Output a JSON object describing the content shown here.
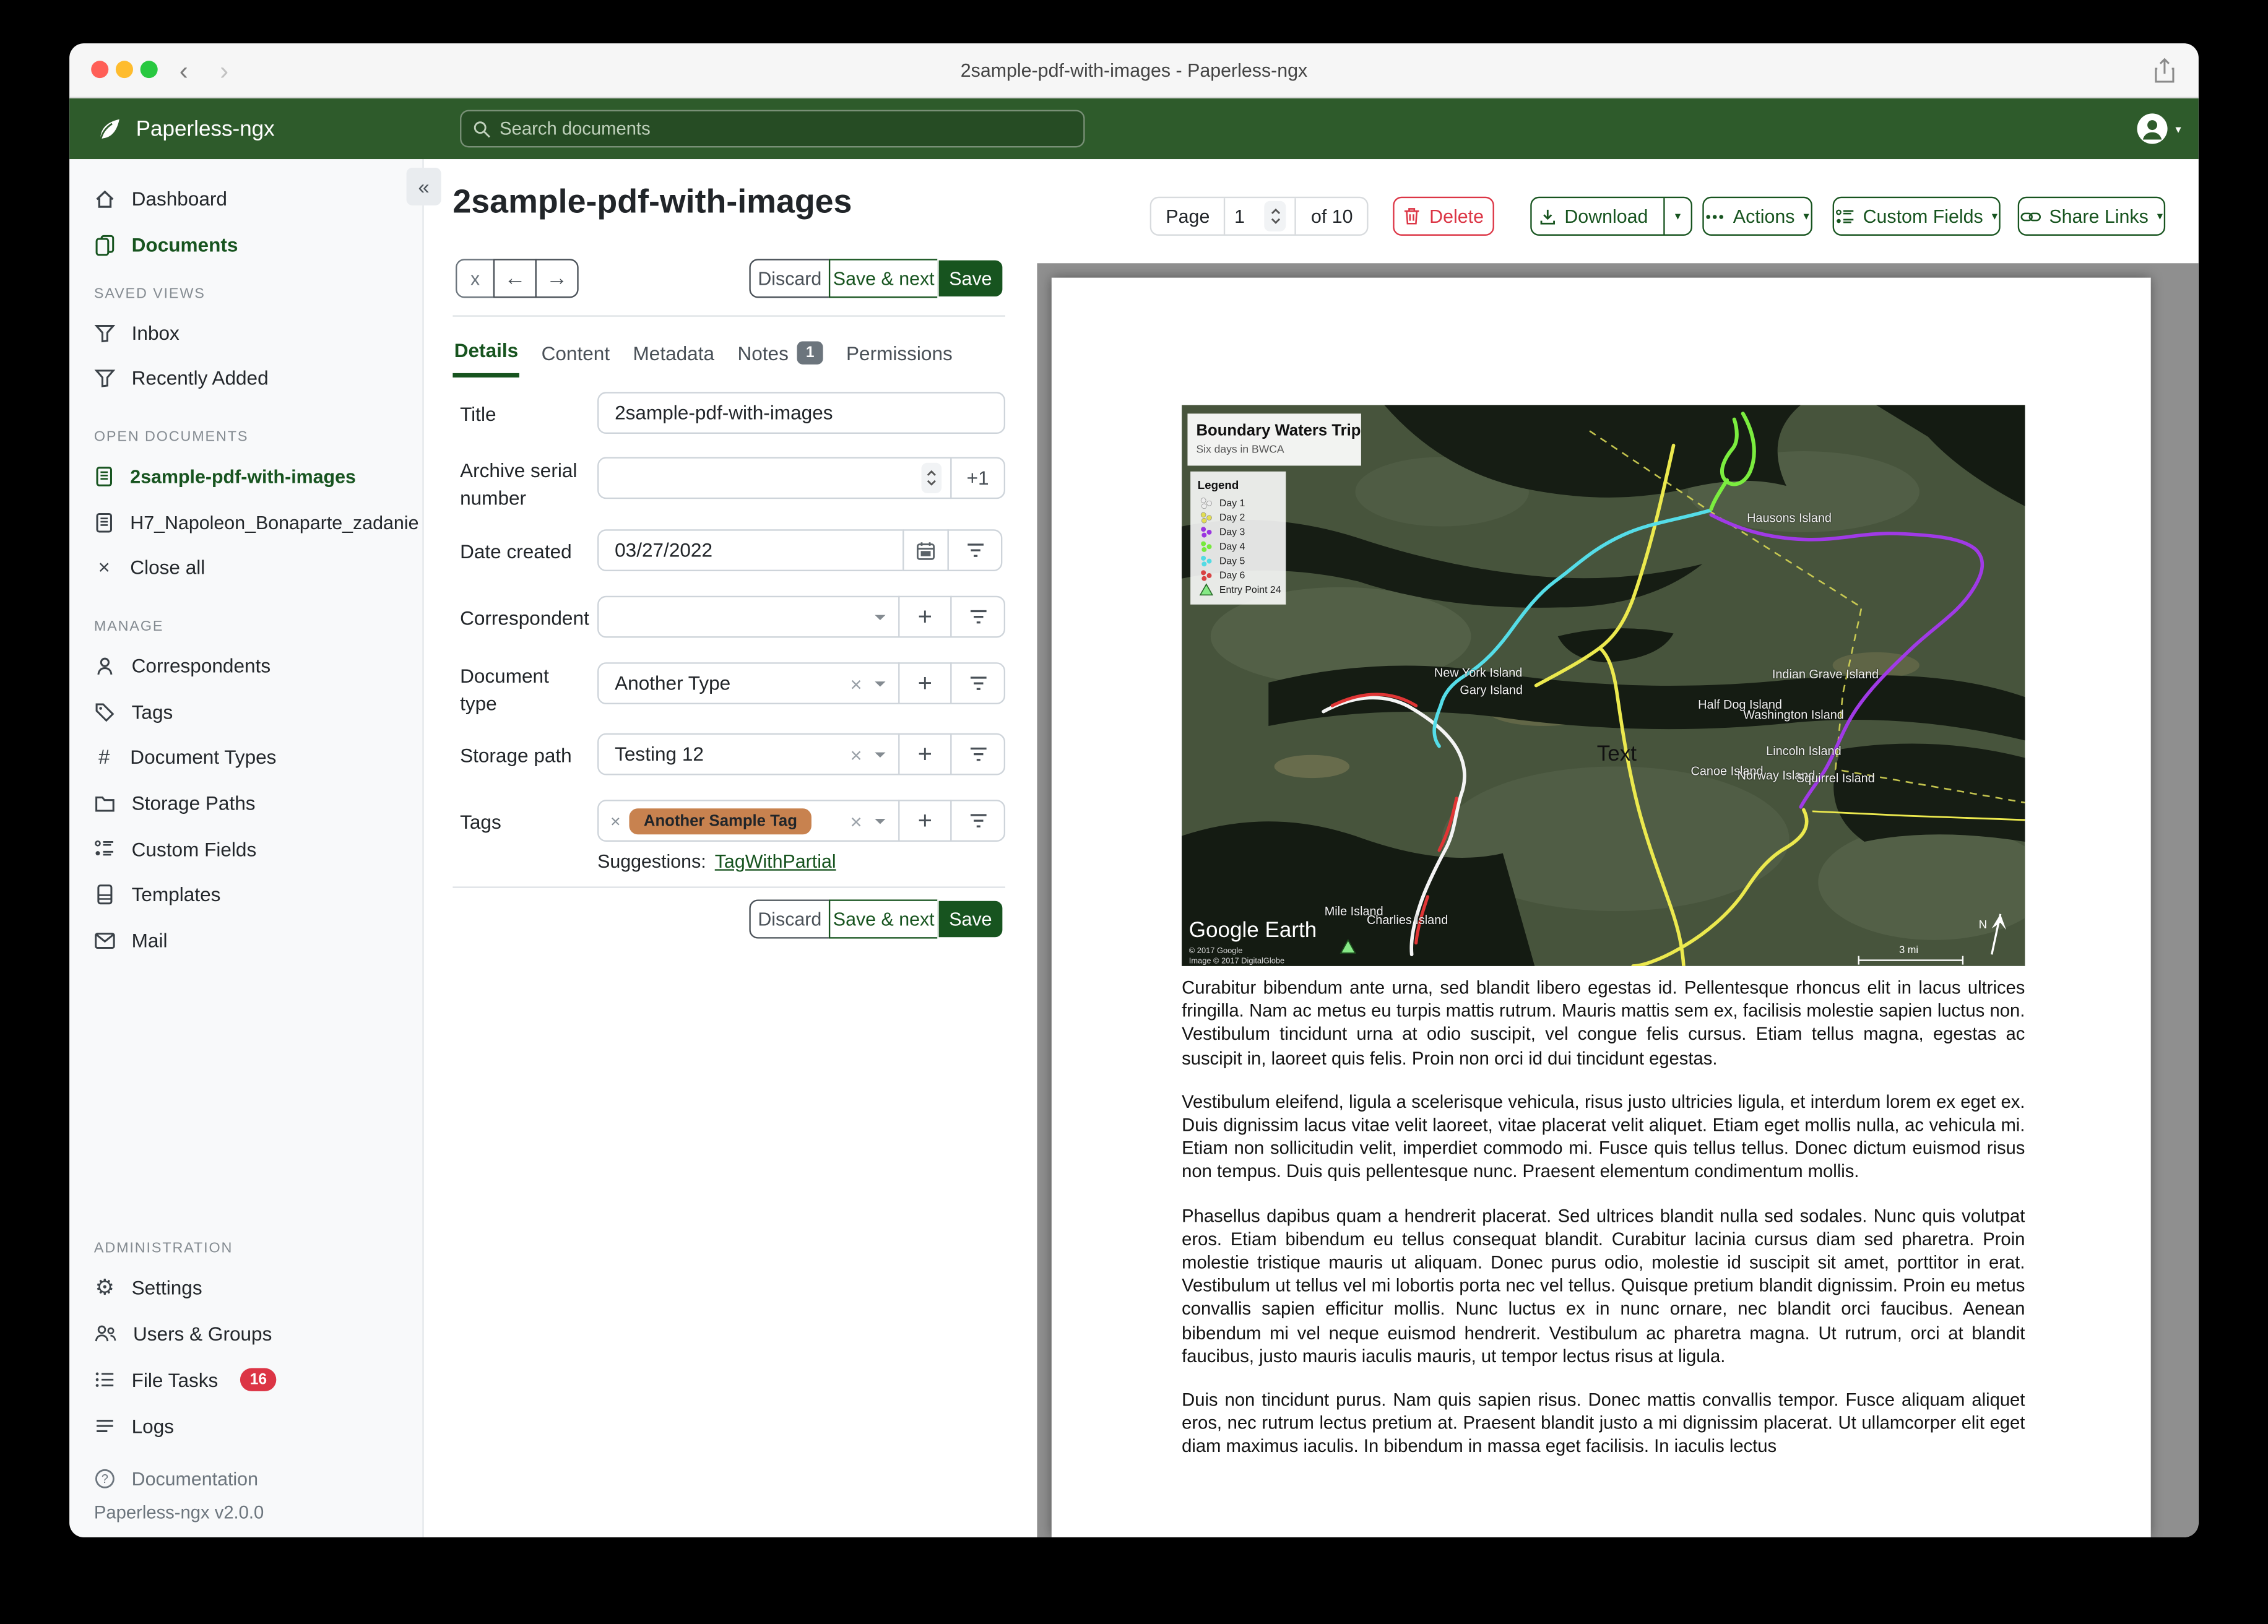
{
  "titlebar": {
    "title": "2sample-pdf-with-images - Paperless-ngx"
  },
  "navbar": {
    "brand": "Paperless-ngx",
    "search_placeholder": "Search documents"
  },
  "sidebar": {
    "primary": [
      {
        "label": "Dashboard"
      },
      {
        "label": "Documents"
      }
    ],
    "sections": [
      {
        "title": "SAVED VIEWS",
        "items": [
          {
            "label": "Inbox"
          },
          {
            "label": "Recently Added"
          }
        ]
      },
      {
        "title": "OPEN DOCUMENTS",
        "items": [
          {
            "label": "2sample-pdf-with-images"
          },
          {
            "label": "H7_Napoleon_Bonaparte_zadanie"
          },
          {
            "label": "Close all"
          }
        ]
      },
      {
        "title": "MANAGE",
        "items": [
          {
            "label": "Correspondents"
          },
          {
            "label": "Tags"
          },
          {
            "label": "Document Types"
          },
          {
            "label": "Storage Paths"
          },
          {
            "label": "Custom Fields"
          },
          {
            "label": "Templates"
          },
          {
            "label": "Mail"
          }
        ]
      },
      {
        "title": "ADMINISTRATION",
        "items": [
          {
            "label": "Settings"
          },
          {
            "label": "Users & Groups"
          },
          {
            "label": "File Tasks",
            "badge": "16"
          },
          {
            "label": "Logs"
          }
        ]
      }
    ],
    "footer": {
      "documentation": "Documentation",
      "version": "Paperless-ngx v2.0.0"
    }
  },
  "header": {
    "title": "2sample-pdf-with-images",
    "page_label": "Page",
    "page_value": "1",
    "page_of": "of 10",
    "delete_label": "Delete",
    "download_label": "Download",
    "actions_label": "Actions",
    "custom_fields_label": "Custom Fields",
    "share_links_label": "Share Links"
  },
  "editor": {
    "discard_label": "Discard",
    "save_next_label": "Save & next",
    "save_label": "Save",
    "tabs": [
      {
        "label": "Details"
      },
      {
        "label": "Content"
      },
      {
        "label": "Metadata"
      },
      {
        "label": "Notes",
        "badge": "1"
      },
      {
        "label": "Permissions"
      }
    ],
    "title": {
      "label": "Title",
      "value": "2sample-pdf-with-images"
    },
    "asn": {
      "label": "Archive serial number",
      "value": "",
      "increment_label": "+1"
    },
    "date_created": {
      "label": "Date created",
      "value": "03/27/2022"
    },
    "correspondent": {
      "label": "Correspondent",
      "value": ""
    },
    "document_type": {
      "label": "Document type",
      "value": "Another Type"
    },
    "storage_path": {
      "label": "Storage path",
      "value": "Testing 12"
    },
    "tags": {
      "label": "Tags",
      "chip": "Another Sample Tag",
      "chip_color": "#c8824f",
      "suggestions_label": "Suggestions:",
      "suggestion_link": "TagWithPartial"
    }
  },
  "preview": {
    "map": {
      "title": "Boundary Waters Trip",
      "subtitle": "Six days in BWCA",
      "legend_title": "Legend",
      "legend": [
        {
          "label": "Day 1",
          "color": "#ededed"
        },
        {
          "label": "Day 2",
          "color": "#e2de52"
        },
        {
          "label": "Day 3",
          "color": "#9a35e0"
        },
        {
          "label": "Day 4",
          "color": "#77e93d"
        },
        {
          "label": "Day 5",
          "color": "#52dbe4"
        },
        {
          "label": "Day 6",
          "color": "#d84343"
        },
        {
          "label": "Entry Point 24",
          "color": "#86e986"
        }
      ],
      "routes": {
        "day1": "#f4f4f4",
        "day2": "#ece94e",
        "day3": "#a03ae6",
        "day4": "#7bed3f",
        "day5": "#55dde8",
        "day6": "#e03535",
        "boundary": "#d6d654"
      },
      "islands": [
        "Hausons Island",
        "New York Island",
        "Gary Island",
        "Indian Grave Island",
        "Half Dog Island",
        "Washington Island",
        "Lincoln Island",
        "Canoe Island",
        "Norway Island",
        "Squirrel Island",
        "Mile Island",
        "Charlies Island"
      ],
      "annotation": "Text",
      "credit_brand": "Google Earth",
      "credit_line1": "© 2017 Google",
      "credit_line2": "Image © 2017 DigitalGlobe",
      "scale_label": "3 mi",
      "compass_label": "N"
    },
    "paragraphs": [
      "Curabitur bibendum ante urna, sed blandit libero egestas id. Pellentesque rhoncus elit in lacus ultrices fringilla. Nam ac metus eu turpis mattis rutrum. Mauris mattis sem ex, facilisis molestie sapien luctus non. Vestibulum tincidunt urna at odio suscipit, vel congue felis cursus. Etiam tellus magna, egestas ac suscipit in, laoreet quis felis. Proin non orci id dui tincidunt egestas.",
      "Vestibulum eleifend, ligula a scelerisque vehicula, risus justo ultricies ligula, et interdum lorem ex eget ex. Duis dignissim lacus vitae velit laoreet, vitae placerat velit aliquet. Etiam eget mollis nulla, ac vehicula mi. Etiam non sollicitudin velit, imperdiet commodo mi. Fusce quis tellus tellus. Donec dictum euismod risus non tempus. Duis quis pellentesque nunc. Praesent elementum condimentum mollis.",
      "Phasellus dapibus quam a hendrerit placerat. Sed ultrices blandit nulla sed sodales. Nunc quis volutpat eros. Etiam bibendum eu tellus consequat blandit. Curabitur lacinia cursus diam sed pharetra. Proin molestie tristique mauris ut aliquam. Donec purus odio, molestie id suscipit sit amet, porttitor in erat. Vestibulum ut tellus vel mi lobortis porta nec vel tellus. Quisque pretium blandit dignissim. Proin eu metus convallis sapien efficitur mollis. Nunc luctus ex in nunc ornare, nec blandit orci faucibus. Aenean bibendum mi vel neque euismod hendrerit. Vestibulum ac pharetra magna. Ut rutrum, orci at blandit faucibus, justo mauris iaculis mauris, ut tempor lectus risus at ligula.",
      "Duis non tincidunt purus. Nam quis sapien risus. Donec mattis convallis tempor. Fusce aliquam aliquet eros, nec rutrum lectus pretium at. Praesent blandit justo a mi dignissim placerat. Ut ullamcorper elit eget diam maximus iaculis. In bibendum in massa eget facilisis. In iaculis lectus"
    ]
  }
}
